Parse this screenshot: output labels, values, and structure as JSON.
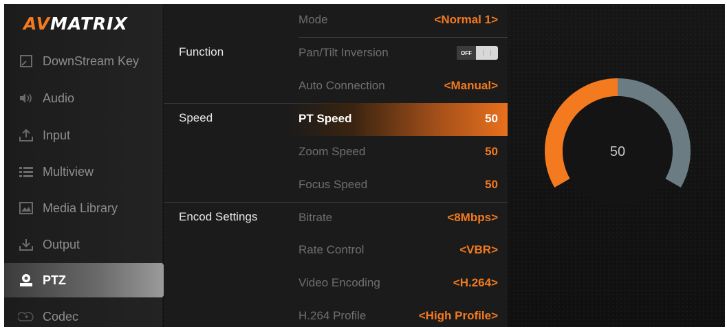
{
  "brand": {
    "logo_left": "AV",
    "logo_right": "MATRIX",
    "accent_color": "#f47a1f"
  },
  "sidebar": {
    "items": [
      {
        "label": "DownStream Key",
        "icon": "downstream-key-icon",
        "active": false
      },
      {
        "label": "Audio",
        "icon": "speaker-icon",
        "active": false
      },
      {
        "label": "Input",
        "icon": "upload-icon",
        "active": false
      },
      {
        "label": "Multiview",
        "icon": "list-icon",
        "active": false
      },
      {
        "label": "Media Library",
        "icon": "image-icon",
        "active": false
      },
      {
        "label": "Output",
        "icon": "download-icon",
        "active": false
      },
      {
        "label": "PTZ",
        "icon": "camera-icon",
        "active": true
      },
      {
        "label": "Codec",
        "icon": "codec-icon",
        "active": false
      }
    ]
  },
  "settings": {
    "mode": {
      "label": "Mode",
      "value": "<Normal 1>"
    },
    "function": {
      "section": "Function",
      "pan_tilt_inversion": {
        "label": "Pan/Tilt Inversion",
        "toggle": "OFF"
      },
      "auto_connection": {
        "label": "Auto Connection",
        "value": "<Manual>"
      }
    },
    "speed": {
      "section": "Speed",
      "pt_speed": {
        "label": "PT Speed",
        "value": "50"
      },
      "zoom_speed": {
        "label": "Zoom Speed",
        "value": "50"
      },
      "focus_speed": {
        "label": "Focus Speed",
        "value": "50"
      }
    },
    "encode": {
      "section": "Encod Settings",
      "bitrate": {
        "label": "Bitrate",
        "value": "<8Mbps>"
      },
      "rate_control": {
        "label": "Rate Control",
        "value": "<VBR>"
      },
      "video_encoding": {
        "label": "Video Encoding",
        "value": "<H.264>"
      },
      "h264_profile": {
        "label": "H.264 Profile",
        "value": "<High Profile>"
      }
    }
  },
  "gauge": {
    "value": "50",
    "fraction": 0.5,
    "fill_color": "#f47a1f",
    "track_color": "#6b7c83",
    "center_color": "#141414"
  }
}
